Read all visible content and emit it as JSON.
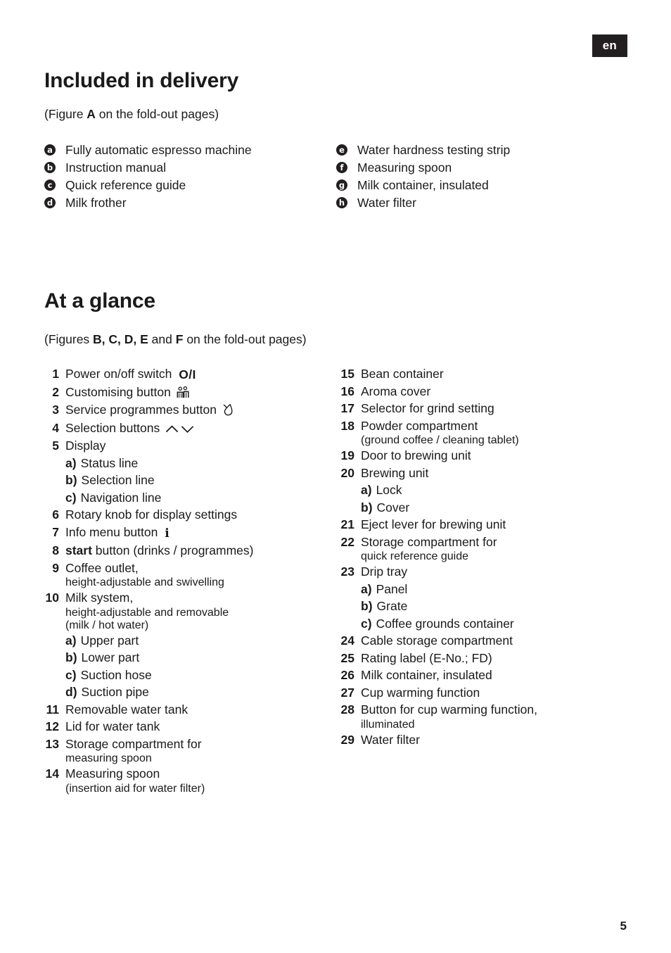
{
  "page": {
    "language_tab": "en",
    "page_number": "5"
  },
  "sections": [
    {
      "id": "included-in-delivery",
      "title": "Included in delivery",
      "subtitle_prefix": "(Figure ",
      "subtitle_bold": "A",
      "subtitle_suffix": " on the fold-out pages)"
    },
    {
      "id": "at-a-glance",
      "title": "At a glance",
      "subtitle_prefix": "(Figures ",
      "subtitle_bold": "B, C, D, E",
      "subtitle_mid": " and ",
      "subtitle_bold2": "F",
      "subtitle_suffix": " on the fold-out pages)"
    }
  ],
  "delivery": {
    "left": [
      {
        "marker": "a",
        "label": "Fully automatic espresso machine"
      },
      {
        "marker": "b",
        "label": "Instruction manual"
      },
      {
        "marker": "c",
        "label": "Quick reference guide"
      },
      {
        "marker": "d",
        "label": "Milk frother"
      }
    ],
    "right": [
      {
        "marker": "e",
        "label": "Water hardness testing strip"
      },
      {
        "marker": "f",
        "label": "Measuring spoon"
      },
      {
        "marker": "g",
        "label": "Milk container, insulated"
      },
      {
        "marker": "h",
        "label": "Water filter"
      }
    ]
  },
  "glance": {
    "left": [
      {
        "num": "1",
        "label": "Power on/off switch ",
        "icon": "power-on-off-icon",
        "icon_text": "O/I"
      },
      {
        "num": "2",
        "label": "Customising button ",
        "icon": "customising-personalisation-icon"
      },
      {
        "num": "3",
        "label": "Service programmes button ",
        "icon": "service-programmes-droplet-icon"
      },
      {
        "num": "4",
        "label": "Selection buttons ",
        "icon": "selection-up-down-arrows-icon"
      },
      {
        "num": "5",
        "label": "Display",
        "subs": [
          {
            "letter": "a)",
            "label": "Status line"
          },
          {
            "letter": "b)",
            "label": "Selection line"
          },
          {
            "letter": "c)",
            "label": "Navigation line"
          }
        ]
      },
      {
        "num": "6",
        "label": "Rotary knob for display settings"
      },
      {
        "num": "7",
        "label": "Info menu button ",
        "icon": "info-menu-icon",
        "icon_text": "i"
      },
      {
        "num": "8",
        "bold_lead": "start",
        "label": " button (drinks / programmes)"
      },
      {
        "num": "9",
        "label": "Coffee outlet,",
        "cont": [
          "height-adjustable and swivelling"
        ]
      },
      {
        "num": "10",
        "label": "Milk system,",
        "cont": [
          "height-adjustable and removable",
          "(milk / hot water)"
        ],
        "subs": [
          {
            "letter": "a)",
            "label": "Upper part"
          },
          {
            "letter": "b)",
            "label": "Lower part"
          },
          {
            "letter": "c)",
            "label": "Suction hose"
          },
          {
            "letter": "d)",
            "label": "Suction pipe"
          }
        ]
      },
      {
        "num": "11",
        "label": "Removable water tank"
      },
      {
        "num": "12",
        "label": "Lid for water tank"
      },
      {
        "num": "13",
        "label": "Storage compartment for",
        "cont": [
          "measuring spoon"
        ]
      },
      {
        "num": "14",
        "label": "Measuring spoon",
        "cont": [
          "(insertion aid for water filter)"
        ]
      }
    ],
    "right": [
      {
        "num": "15",
        "label": "Bean container"
      },
      {
        "num": "16",
        "label": "Aroma cover"
      },
      {
        "num": "17",
        "label": "Selector for grind setting"
      },
      {
        "num": "18",
        "label": "Powder compartment",
        "cont": [
          "(ground coffee / cleaning tablet)"
        ]
      },
      {
        "num": "19",
        "label": "Door to brewing unit"
      },
      {
        "num": "20",
        "label": "Brewing unit",
        "subs": [
          {
            "letter": "a)",
            "label": "Lock"
          },
          {
            "letter": "b)",
            "label": "Cover"
          }
        ]
      },
      {
        "num": "21",
        "label": "Eject lever for brewing unit"
      },
      {
        "num": "22",
        "label": "Storage compartment for",
        "cont": [
          "quick reference guide"
        ]
      },
      {
        "num": "23",
        "label": "Drip tray",
        "subs": [
          {
            "letter": "a)",
            "label": "Panel"
          },
          {
            "letter": "b)",
            "label": "Grate"
          },
          {
            "letter": "c)",
            "label": "Coffee grounds container"
          }
        ]
      },
      {
        "num": "24",
        "label": "Cable storage compartment"
      },
      {
        "num": "25",
        "label": "Rating label (E-No.; FD)"
      },
      {
        "num": "26",
        "label": "Milk container, insulated"
      },
      {
        "num": "27",
        "label": "Cup warming function"
      },
      {
        "num": "28",
        "label": "Button for cup warming function,",
        "cont": [
          "illuminated"
        ]
      },
      {
        "num": "29",
        "label": "Water filter"
      }
    ]
  },
  "colors": {
    "ink": "#1a1a1a",
    "tab_background": "#231f20",
    "tab_text": "#ffffff",
    "paper": "#ffffff"
  }
}
